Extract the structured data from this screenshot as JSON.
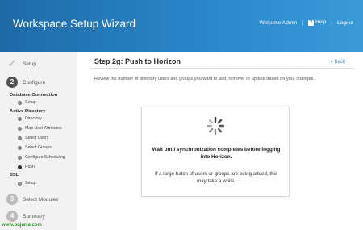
{
  "header": {
    "title": "Workspace Setup Wizard",
    "welcome": "Welcome Admin",
    "help": "Help",
    "logout": "Logout",
    "separator": "|"
  },
  "sidebar": {
    "steps": [
      {
        "number": "",
        "label": "Setup",
        "state": "done"
      },
      {
        "number": "2",
        "label": "Configure",
        "state": "active"
      },
      {
        "number": "3",
        "label": "Select Modules",
        "state": "pending"
      },
      {
        "number": "4",
        "label": "Summary",
        "state": "pending"
      }
    ],
    "sections": {
      "database": "Database Connection",
      "active_directory": "Active Directory",
      "ssl": "SSL"
    },
    "substeps": {
      "db_setup": "Setup",
      "directory": "Directory",
      "map_user_attributes": "Map User Attributes",
      "select_users": "Select Users",
      "select_groups": "Select Groups",
      "configure_scheduling": "Configure Scheduling",
      "push": "Push",
      "ssl_setup": "Setup"
    }
  },
  "main": {
    "title": "Step 2g: Push to Horizon",
    "back": "< Back",
    "instructions": "Review the number of directory users and groups you want to add, remove, or update based on your changes."
  },
  "dialog": {
    "bold_text": "Wait until synchronization completes before logging into Horizon.",
    "info_text": "If a large batch of users or groups are being added, this may take a while."
  },
  "watermark": "www.bujarra.com",
  "colors": {
    "header_start": "#1e6aa8",
    "header_end": "#3a9ad8",
    "link": "#2a86c8",
    "sidebar_bg": "#f2f2f2"
  }
}
